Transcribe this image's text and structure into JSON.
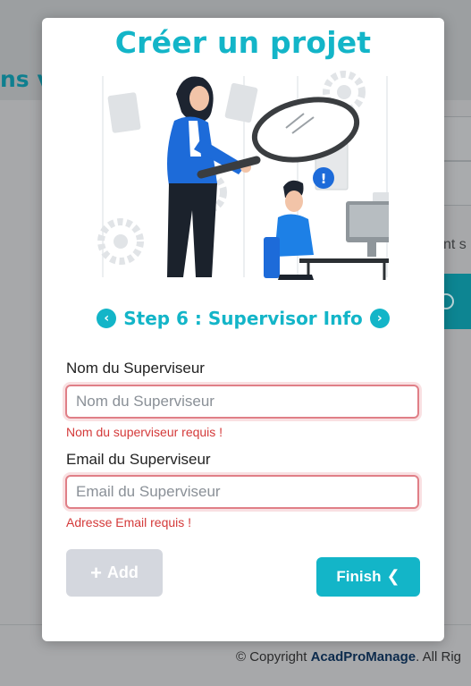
{
  "background": {
    "title_fragment": "ns v",
    "side_text_fragment": "nt s",
    "footer": {
      "prefix": "© Copyright ",
      "brand": "AcadProManage",
      "suffix": ". All Rig"
    }
  },
  "modal": {
    "title": "Créer un projet",
    "step": {
      "prev_glyph": "‹",
      "label": "Step 6 : Supervisor Info",
      "next_glyph": "›"
    },
    "supervisor_name": {
      "label": "Nom du Superviseur",
      "placeholder": "Nom du Superviseur",
      "value": "",
      "error": "Nom du superviseur requis !"
    },
    "supervisor_email": {
      "label": "Email du Superviseur",
      "placeholder": "Email du Superviseur",
      "value": "",
      "error": "Adresse Email requis !"
    },
    "add_button": {
      "icon": "plus-icon",
      "label": "Add"
    },
    "finish_button": {
      "label": "Finish",
      "icon": "chevron-left-icon"
    }
  },
  "colors": {
    "accent": "#13b5c8",
    "error": "#d43a3a",
    "disabled": "#d4d7de"
  }
}
